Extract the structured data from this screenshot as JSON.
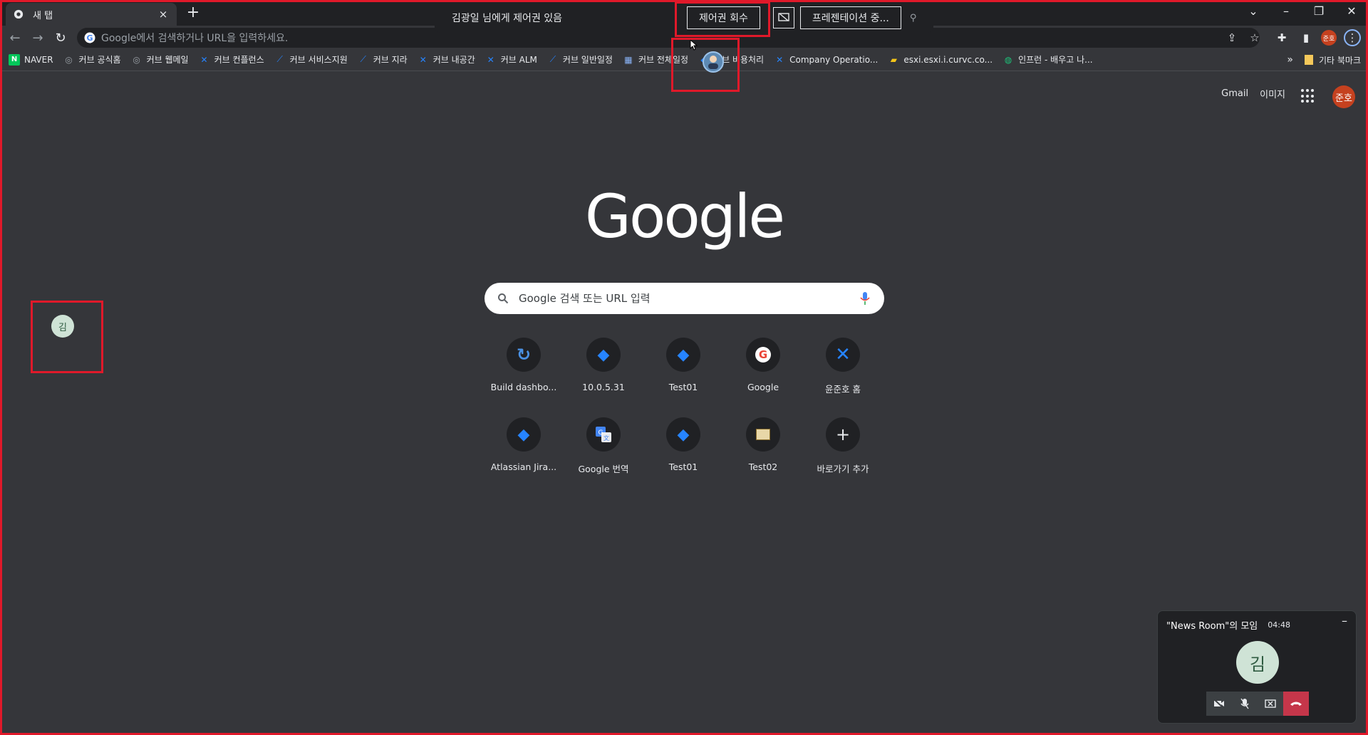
{
  "tab": {
    "title": "새 탭",
    "close": "×"
  },
  "newtab": "+",
  "sharing": {
    "message": "김광일 님에게 제어권 있음",
    "revoke_label": "제어권 회수",
    "presentation_label": "프레젠테이션 중..."
  },
  "omnibox": {
    "placeholder": "Google에서 검색하거나 URL을 입력하세요."
  },
  "profile": {
    "initials": "준호"
  },
  "bookmarks": [
    {
      "label": "NAVER",
      "icon": "naver-icon"
    },
    {
      "label": "커브 공식홈",
      "icon": "globe-icon"
    },
    {
      "label": "커브 웹메일",
      "icon": "globe-icon"
    },
    {
      "label": "커브 컨플런스",
      "icon": "confluence-icon"
    },
    {
      "label": "커브 서비스지원",
      "icon": "jira-icon"
    },
    {
      "label": "커브 지라",
      "icon": "jira-icon"
    },
    {
      "label": "커브 내공간",
      "icon": "confluence-icon"
    },
    {
      "label": "커브 ALM",
      "icon": "confluence-icon"
    },
    {
      "label": "커브 일반일정",
      "icon": "jira-icon"
    },
    {
      "label": "커브 전체일정",
      "icon": "calendar-icon"
    },
    {
      "label": "커브 비용처리",
      "icon": "jira-diamond-icon"
    },
    {
      "label": "Company Operatio...",
      "icon": "confluence-icon"
    },
    {
      "label": "esxi.esxi.i.curvc.co...",
      "icon": "vmware-icon"
    },
    {
      "label": "인프런 - 배우고 나...",
      "icon": "inflearn-icon"
    }
  ],
  "bookmarks_more": "»",
  "other_bookmarks": "기타 북마크",
  "ntp": {
    "gmail": "Gmail",
    "images": "이미지",
    "logo": "Google",
    "search_placeholder": "Google 검색 또는 URL 입력",
    "avatar": "준호"
  },
  "shortcuts": [
    {
      "label": "Build dashbo...",
      "icon": "build-dashboard-icon"
    },
    {
      "label": "10.0.5.31",
      "icon": "jira-diamond-icon"
    },
    {
      "label": "Test01",
      "icon": "jira-diamond-icon"
    },
    {
      "label": "Google",
      "icon": "google-icon"
    },
    {
      "label": "윤준호 홈",
      "icon": "confluence-icon"
    },
    {
      "label": "Atlassian Jira...",
      "icon": "jira-diamond-icon"
    },
    {
      "label": "Google 번역",
      "icon": "google-translate-icon"
    },
    {
      "label": "Test01",
      "icon": "jira-diamond-icon"
    },
    {
      "label": "Test02",
      "icon": "test02-thumb-icon"
    },
    {
      "label": "바로가기 추가",
      "icon": "plus-icon"
    }
  ],
  "remote_cursor": {
    "initial": "김"
  },
  "meeting": {
    "title": "\"News Room\"의 모임",
    "time": "04:48",
    "minimize": "–",
    "participant_initial": "김"
  },
  "colors": {
    "accent_red": "#e0192a",
    "bg": "#35363a",
    "chrome": "#202124"
  }
}
